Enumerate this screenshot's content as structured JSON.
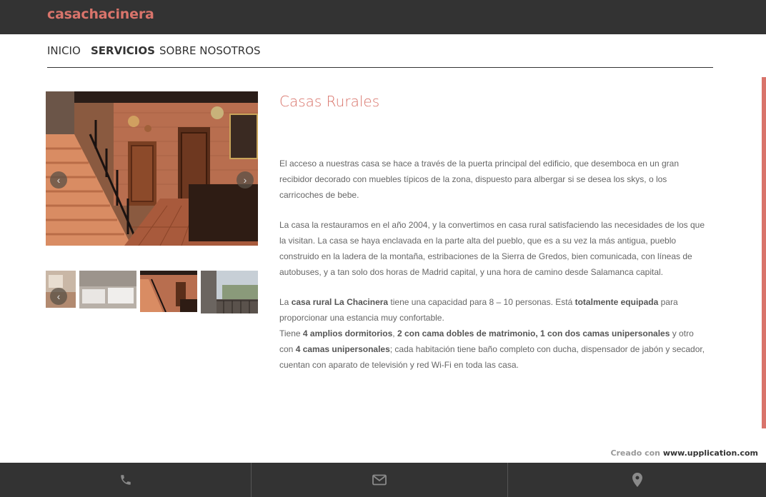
{
  "brand": "casachacinera",
  "nav": {
    "inicio": "INICIO",
    "servicios": "SERVICIOS",
    "sobre": "SOBRE NOSOTROS"
  },
  "content": {
    "title": "Casas Rurales",
    "p1": "El acceso a nuestras casa se hace a través de la puerta principal del edificio, que desemboca en un gran recibidor decorado con muebles típicos de la zona, dispuesto para albergar si se desea los skys, o los carricoches de bebe.",
    "p2": "La casa la restauramos en el año 2004, y la convertimos en casa rural satisfaciendo las necesidades de los que la visitan. La casa se haya enclavada en la parte alta del pueblo, que es a su vez la más antigua, pueblo construido en la ladera de la montaña, estribaciones de la Sierra de Gredos, bien comunicada, con líneas de autobuses, y a tan solo dos horas de Madrid capital, y una hora de camino desde Salamanca capital.",
    "p3": {
      "t1": "La ",
      "b1": "casa rural La Chacinera",
      "t2": " tiene una capacidad para 8 – 10 personas. Está ",
      "b2": "totalmente equipada",
      "t3": " para proporcionar una estancia muy confortable.",
      "t4": "Tiene  ",
      "b3": "4 amplios dormitorios",
      "t5": ", ",
      "b4": "2 con cama dobles de matrimonio, 1 con dos camas unipersonales",
      "t6": "  y otro con  ",
      "b5": "4 camas unipersonales",
      "t7": ";  cada habitación tiene baño completo con ducha, dispensador de jabón y secador, cuentan con aparato de televisión y red Wi-Fi en toda las casa."
    }
  },
  "gallery": {
    "prev_icon": "chevron-left-icon",
    "next_icon": "chevron-right-icon"
  },
  "footer": {
    "credit_prefix": "Creado con ",
    "credit_site": "www.upplication.com",
    "icons": [
      "phone-icon",
      "mail-icon",
      "map-pin-icon"
    ]
  },
  "colors": {
    "accent": "#d9746b",
    "bar": "#333333"
  }
}
